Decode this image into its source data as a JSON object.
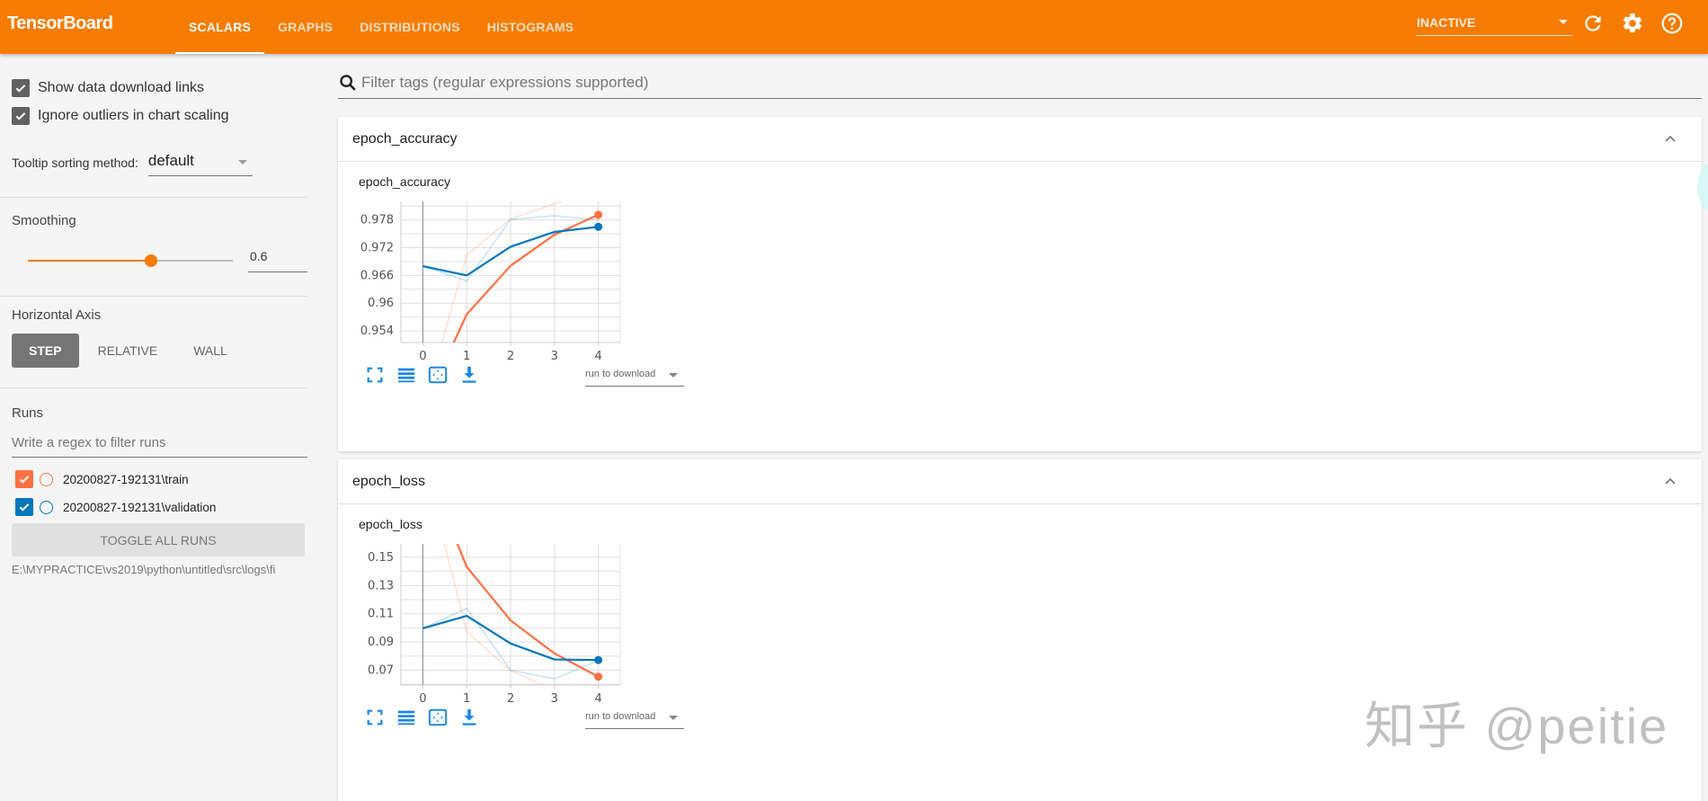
{
  "app": {
    "title": "TensorBoard",
    "tabs": [
      {
        "label": "SCALARS",
        "active": true
      },
      {
        "label": "GRAPHS",
        "active": false
      },
      {
        "label": "DISTRIBUTIONS",
        "active": false
      },
      {
        "label": "HISTOGRAMS",
        "active": false
      }
    ],
    "status_select": "INACTIVE",
    "icons": [
      "refresh-icon",
      "settings-gear-icon",
      "help-icon"
    ],
    "accent_color": "#f57c00"
  },
  "sidebar": {
    "show_download_links": {
      "label": "Show data download links",
      "checked": true
    },
    "ignore_outliers": {
      "label": "Ignore outliers in chart scaling",
      "checked": true
    },
    "tooltip_sort": {
      "label": "Tooltip sorting method:",
      "value": "default"
    },
    "smoothing": {
      "label": "Smoothing",
      "value": "0.6",
      "fraction": 0.6
    },
    "horizontal_axis": {
      "label": "Horizontal Axis",
      "options": [
        {
          "label": "STEP",
          "active": true
        },
        {
          "label": "RELATIVE",
          "active": false
        },
        {
          "label": "WALL",
          "active": false
        }
      ]
    },
    "runs": {
      "label": "Runs",
      "filter_placeholder": "Write a regex to filter runs",
      "items": [
        {
          "name": "20200827-192131\\train",
          "checked": true,
          "color": "#ff7043"
        },
        {
          "name": "20200827-192131\\validation",
          "checked": true,
          "color": "#0077bb"
        }
      ],
      "toggle_all_label": "TOGGLE ALL RUNS",
      "logdir": "E:\\MYPRACTICE\\vs2019\\python\\untitled\\src\\logs\\fi"
    }
  },
  "main": {
    "tag_filter_placeholder": "Filter tags (regular expressions supported)",
    "panes": [
      {
        "title": "epoch_accuracy",
        "card_title": "epoch_accuracy",
        "run_download_label": "run to download"
      },
      {
        "title": "epoch_loss",
        "card_title": "epoch_loss",
        "run_download_label": "run to download"
      }
    ]
  },
  "watermark": "知乎 @peitie",
  "chart_data": [
    {
      "type": "line",
      "title": "epoch_accuracy",
      "xlabel": "",
      "ylabel": "",
      "x": [
        0,
        1,
        2,
        3,
        4
      ],
      "xlim": [
        -0.5,
        4.5
      ],
      "ylim": [
        0.9515,
        0.982
      ],
      "xticks": [
        "0",
        "1",
        "2",
        "3",
        "4"
      ],
      "yticks": [
        0.954,
        0.96,
        0.966,
        0.972,
        0.978
      ],
      "ytick_labels": [
        "0.954",
        "0.96",
        "0.966",
        "0.972",
        "0.978"
      ],
      "grid": true,
      "smoothing": 0.6,
      "series": [
        {
          "name": "20200827-192131\\train",
          "kind": "raw",
          "color": "#ff7043",
          "values": [
            0.937,
            0.9704,
            0.9782,
            0.9815,
            0.9845
          ]
        },
        {
          "name": "20200827-192131\\validation",
          "kind": "raw",
          "color": "#0077bb",
          "values": [
            0.968,
            0.9648,
            0.9781,
            0.9789,
            0.978
          ]
        },
        {
          "name": "20200827-192131\\train",
          "kind": "smoothed",
          "color": "#ff7043",
          "values": [
            0.937,
            0.9576,
            0.9681,
            0.9748,
            0.9791
          ]
        },
        {
          "name": "20200827-192131\\validation",
          "kind": "smoothed",
          "color": "#0077bb",
          "values": [
            0.968,
            0.966,
            0.9722,
            0.9754,
            0.9765
          ]
        }
      ]
    },
    {
      "type": "line",
      "title": "epoch_loss",
      "xlabel": "",
      "ylabel": "",
      "x": [
        0,
        1,
        2,
        3,
        4
      ],
      "xlim": [
        -0.5,
        4.5
      ],
      "ylim": [
        0.0595,
        0.1595
      ],
      "xticks": [
        "0",
        "1",
        "2",
        "3",
        "4"
      ],
      "yticks": [
        0.07,
        0.09,
        0.11,
        0.13,
        0.15
      ],
      "ytick_labels": [
        "0.07",
        "0.09",
        "0.11",
        "0.13",
        "0.15"
      ],
      "grid": true,
      "smoothing": 0.6,
      "series": [
        {
          "name": "20200827-192131\\train",
          "kind": "raw",
          "color": "#ff7043",
          "values": [
            0.22,
            0.0974,
            0.0697,
            0.056,
            0.048
          ]
        },
        {
          "name": "20200827-192131\\validation",
          "kind": "raw",
          "color": "#0077bb",
          "values": [
            0.0997,
            0.1138,
            0.07,
            0.0639,
            0.0769
          ]
        },
        {
          "name": "20200827-192131\\train",
          "kind": "smoothed",
          "color": "#ff7043",
          "values": [
            0.22,
            0.1432,
            0.1053,
            0.0819,
            0.0654
          ]
        },
        {
          "name": "20200827-192131\\validation",
          "kind": "smoothed",
          "color": "#0077bb",
          "values": [
            0.0997,
            0.1085,
            0.0889,
            0.0776,
            0.0772
          ]
        }
      ]
    }
  ]
}
